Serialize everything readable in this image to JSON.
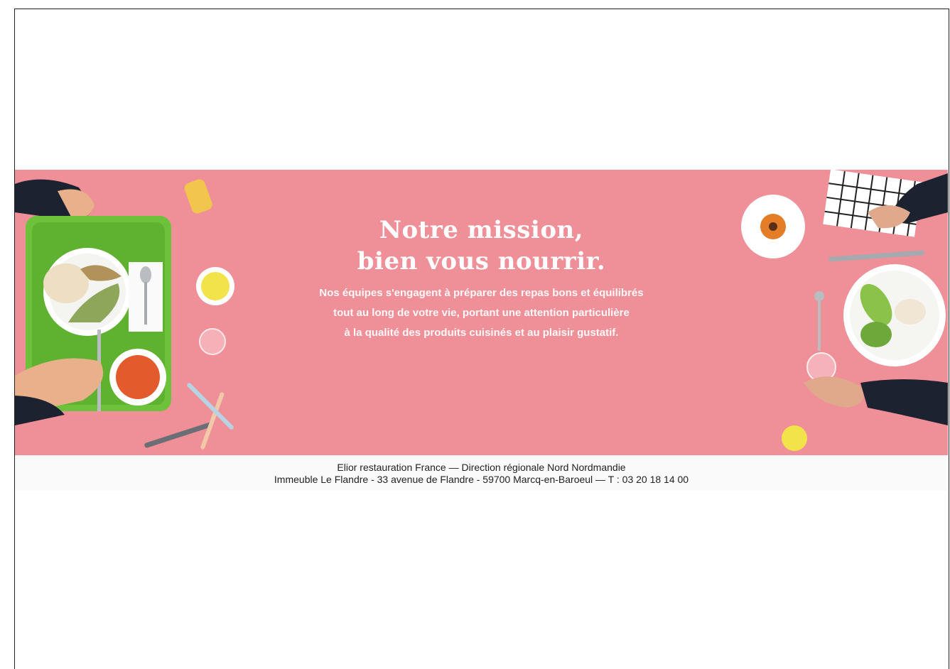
{
  "banner": {
    "headline_line1": "Notre mission,",
    "headline_line2": "bien vous nourrir.",
    "body_lines": [
      "Nos équipes s'engagent à préparer des repas bons et équilibrés",
      "tout au long de votre vie, portant une attention particulière",
      "à la qualité des produits cuisinés et  au plaisir gustatif."
    ],
    "background_color": "#ef8f98"
  },
  "footer": {
    "line1": "Elior restauration France — Direction régionale Nord Nordmandie",
    "line2": "Immeuble Le Flandre - 33 avenue de Flandre - 59700 Marcq-en-Baroeul — T : 03 20 18 14 00"
  }
}
